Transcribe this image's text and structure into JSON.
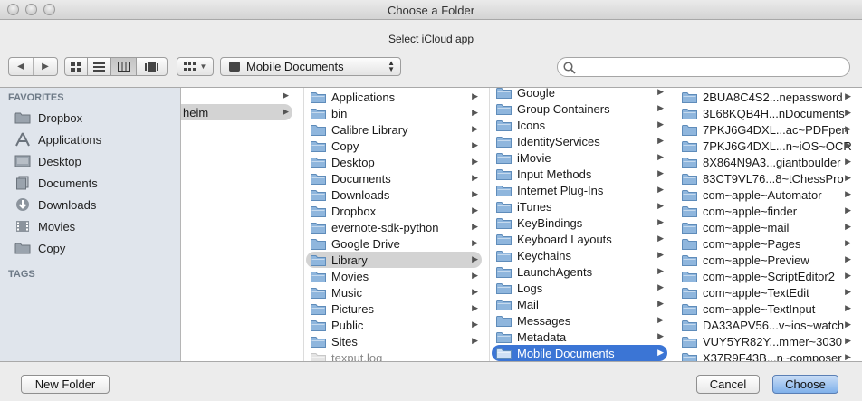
{
  "window": {
    "title": "Choose a Folder",
    "prompt": "Select iCloud app"
  },
  "toolbar": {
    "location": "Mobile Documents",
    "search": {
      "value": "",
      "placeholder": ""
    }
  },
  "sidebar": {
    "favorites_header": "FAVORITES",
    "tags_header": "TAGS",
    "items": [
      {
        "label": "Dropbox",
        "icon": "folder-icon"
      },
      {
        "label": "Applications",
        "icon": "applications-icon"
      },
      {
        "label": "Desktop",
        "icon": "desktop-icon"
      },
      {
        "label": "Documents",
        "icon": "documents-icon"
      },
      {
        "label": "Downloads",
        "icon": "downloads-icon"
      },
      {
        "label": "Movies",
        "icon": "movies-icon"
      },
      {
        "label": "Copy",
        "icon": "folder-icon"
      }
    ]
  },
  "columns": [
    {
      "items": [
        {
          "label": "",
          "arrow": true
        },
        {
          "label": "heim",
          "arrow": true,
          "state": "grey"
        }
      ]
    },
    {
      "items": [
        {
          "label": "Applications",
          "arrow": true
        },
        {
          "label": "bin",
          "arrow": true
        },
        {
          "label": "Calibre Library",
          "arrow": true
        },
        {
          "label": "Copy",
          "arrow": true
        },
        {
          "label": "Desktop",
          "arrow": true
        },
        {
          "label": "Documents",
          "arrow": true
        },
        {
          "label": "Downloads",
          "arrow": true
        },
        {
          "label": "Dropbox",
          "arrow": true
        },
        {
          "label": "evernote-sdk-python",
          "arrow": true
        },
        {
          "label": "Google Drive",
          "arrow": true
        },
        {
          "label": "Library",
          "arrow": true,
          "state": "grey"
        },
        {
          "label": "Movies",
          "arrow": true
        },
        {
          "label": "Music",
          "arrow": true
        },
        {
          "label": "Pictures",
          "arrow": true
        },
        {
          "label": "Public",
          "arrow": true
        },
        {
          "label": "Sites",
          "arrow": true
        },
        {
          "label": "texput.log",
          "arrow": false,
          "state": "dim"
        }
      ]
    },
    {
      "items": [
        {
          "label": "Google",
          "arrow": true
        },
        {
          "label": "Group Containers",
          "arrow": true
        },
        {
          "label": "Icons",
          "arrow": true
        },
        {
          "label": "IdentityServices",
          "arrow": true
        },
        {
          "label": "iMovie",
          "arrow": true
        },
        {
          "label": "Input Methods",
          "arrow": true
        },
        {
          "label": "Internet Plug-Ins",
          "arrow": true
        },
        {
          "label": "iTunes",
          "arrow": true
        },
        {
          "label": "KeyBindings",
          "arrow": true
        },
        {
          "label": "Keyboard Layouts",
          "arrow": true
        },
        {
          "label": "Keychains",
          "arrow": true
        },
        {
          "label": "LaunchAgents",
          "arrow": true
        },
        {
          "label": "Logs",
          "arrow": true
        },
        {
          "label": "Mail",
          "arrow": true
        },
        {
          "label": "Messages",
          "arrow": true
        },
        {
          "label": "Metadata",
          "arrow": true
        },
        {
          "label": "Mobile Documents",
          "arrow": true,
          "state": "blue"
        }
      ]
    },
    {
      "items": [
        {
          "label": "2BUA8C4S2...nepassword",
          "arrow": true
        },
        {
          "label": "3L68KQB4H...nDocuments",
          "arrow": true
        },
        {
          "label": "7PKJ6G4DXL...ac~PDFpen",
          "arrow": true
        },
        {
          "label": "7PKJ6G4DXL...n~iOS~OCR",
          "arrow": true
        },
        {
          "label": "8X864N9A3...giantboulder",
          "arrow": true
        },
        {
          "label": "83CT9VL76...8~tChessPro",
          "arrow": true
        },
        {
          "label": "com~apple~Automator",
          "arrow": true
        },
        {
          "label": "com~apple~finder",
          "arrow": true
        },
        {
          "label": "com~apple~mail",
          "arrow": true
        },
        {
          "label": "com~apple~Pages",
          "arrow": true
        },
        {
          "label": "com~apple~Preview",
          "arrow": true
        },
        {
          "label": "com~apple~ScriptEditor2",
          "arrow": true
        },
        {
          "label": "com~apple~TextEdit",
          "arrow": true
        },
        {
          "label": "com~apple~TextInput",
          "arrow": true
        },
        {
          "label": "DA33APV56...v~ios~watch",
          "arrow": true
        },
        {
          "label": "VUY5YR82Y...mmer~3030",
          "arrow": true
        },
        {
          "label": "X37R9F43B...n~composer",
          "arrow": true
        }
      ]
    }
  ],
  "buttons": {
    "new_folder": "New Folder",
    "cancel": "Cancel",
    "choose": "Choose"
  },
  "colors": {
    "selection": "#3b75d5",
    "sidebar_bg": "#e0e5ec",
    "folder": "#8fb6dd"
  }
}
